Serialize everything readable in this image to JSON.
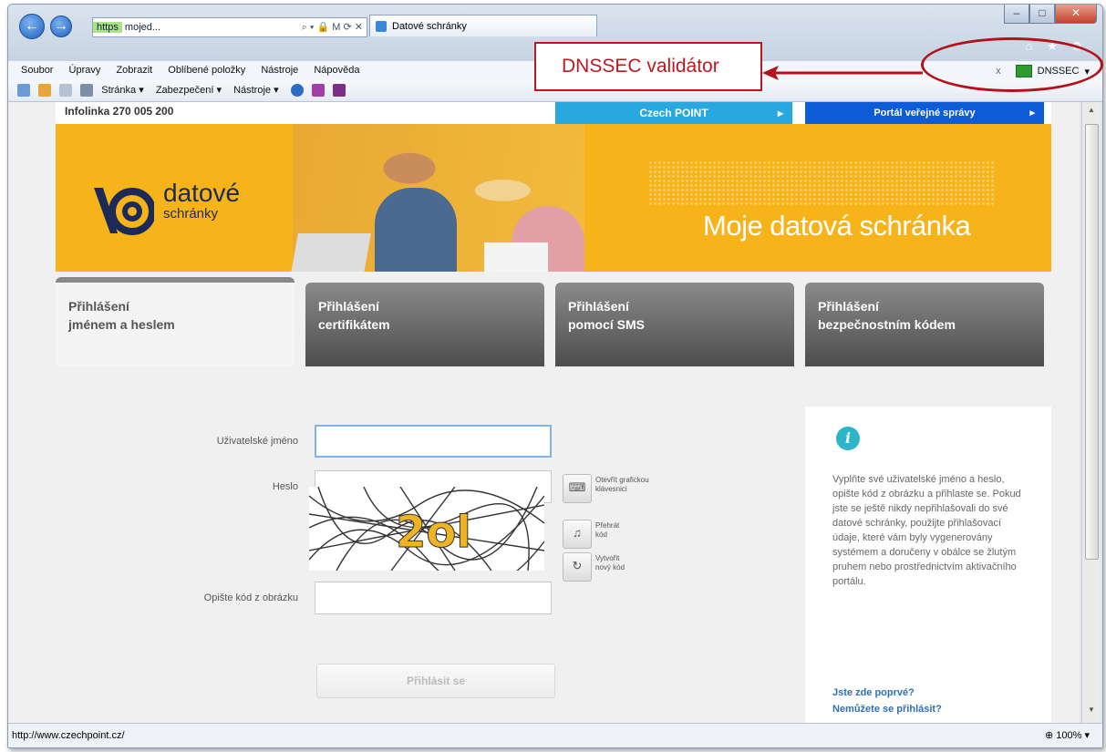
{
  "browser": {
    "address_scheme": "https",
    "address_text": "mojed...",
    "address_controls": "⌕ ▾ 🔒 M ⟳ ✕",
    "tab_title": "Datové schránky",
    "window_icons": "⌂ ★ ⚙",
    "menu": [
      "Soubor",
      "Úpravy",
      "Zobrazit",
      "Oblíbené položky",
      "Nástroje",
      "Nápověda"
    ],
    "cmdbar": [
      "Stránka ▾",
      "Zabezpečení ▾",
      "Nástroje ▾"
    ],
    "dnssec_close": "x",
    "dnssec_label": "DNSSEC",
    "status_url": "http://www.czechpoint.cz/",
    "zoom": "100%"
  },
  "site": {
    "infolinka": "Infolinka 270 005 200",
    "czechpoint": "Czech POINT",
    "portal": "Portál veřejné správy",
    "arrow": "▸",
    "logo_line1": "datové",
    "logo_line2": "schránky",
    "banner_title": "Moje datová schránka"
  },
  "tabs": [
    {
      "line1": "Přihlášení",
      "line2": "jménem a heslem"
    },
    {
      "line1": "Přihlášení",
      "line2": "certifikátem"
    },
    {
      "line1": "Přihlášení",
      "line2": "pomocí SMS"
    },
    {
      "line1": "Přihlášení",
      "line2": "bezpečnostním kódem"
    }
  ],
  "form": {
    "username_label": "Uživatelské jméno",
    "password_label": "Heslo",
    "keyboard_text": "Otevřít grafickou klávesnici",
    "play_text": "Přehrát kód",
    "newcode_text": "Vytvořit nový kód",
    "captcha_label": "Opište kód z obrázku",
    "captcha_code": "2ol",
    "login_button": "Přihlásit se"
  },
  "info": {
    "icon": "i",
    "text": "Vyplňte své uživatelské jméno a heslo, opište kód z obrázku a přihlaste se. Pokud jste se ještě nikdy nepřihlašovali do své datové schránky, použijte přihlašovací údaje, které vám byly vygenerovány systémem a doručeny v obálce se žlutým pruhem nebo prostřednictvím aktivačního portálu.",
    "link1": "Jste zde poprvé?",
    "link2": "Nemůžete se přihlásit?"
  },
  "annotation": {
    "callout": "DNSSEC validátor"
  }
}
